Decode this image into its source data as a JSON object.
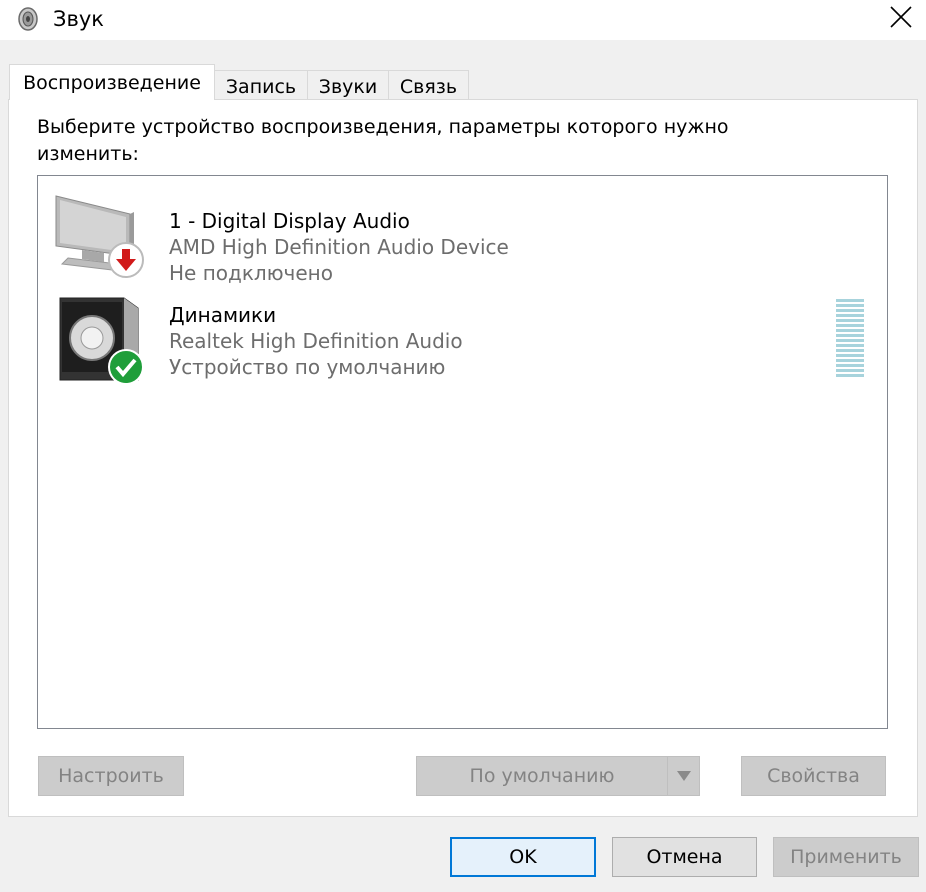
{
  "window": {
    "title": "Звук",
    "app_icon": "speaker-icon",
    "close_icon": "close-icon"
  },
  "tabs": [
    {
      "label": "Воспроизведение",
      "active": true
    },
    {
      "label": "Запись",
      "active": false
    },
    {
      "label": "Звуки",
      "active": false
    },
    {
      "label": "Связь",
      "active": false
    }
  ],
  "main": {
    "instruction_line1": "Выберите устройство воспроизведения, параметры которого нужно",
    "instruction_line2": "изменить:"
  },
  "devices": [
    {
      "name": "1 - Digital Display Audio",
      "driver": "AMD High Definition Audio Device",
      "status": "Не подключено",
      "icon": "monitor-icon",
      "badge_icon": "disconnected-arrow-icon",
      "badge_color": "#d11a1a"
    },
    {
      "name": "Динамики",
      "driver": "Realtek High Definition Audio",
      "status": "Устройство по умолчанию",
      "icon": "speaker-device-icon",
      "badge_icon": "checkmark-icon",
      "badge_color": "#1f9e3a"
    }
  ],
  "list_buttons": {
    "configure": "Настроить",
    "set_default": "По умолчанию",
    "properties": "Свойства"
  },
  "dialog_buttons": {
    "ok": "OK",
    "cancel": "Отмена",
    "apply": "Применить"
  },
  "colors": {
    "accent": "#0078d7",
    "meter": "#a7d3dc"
  }
}
